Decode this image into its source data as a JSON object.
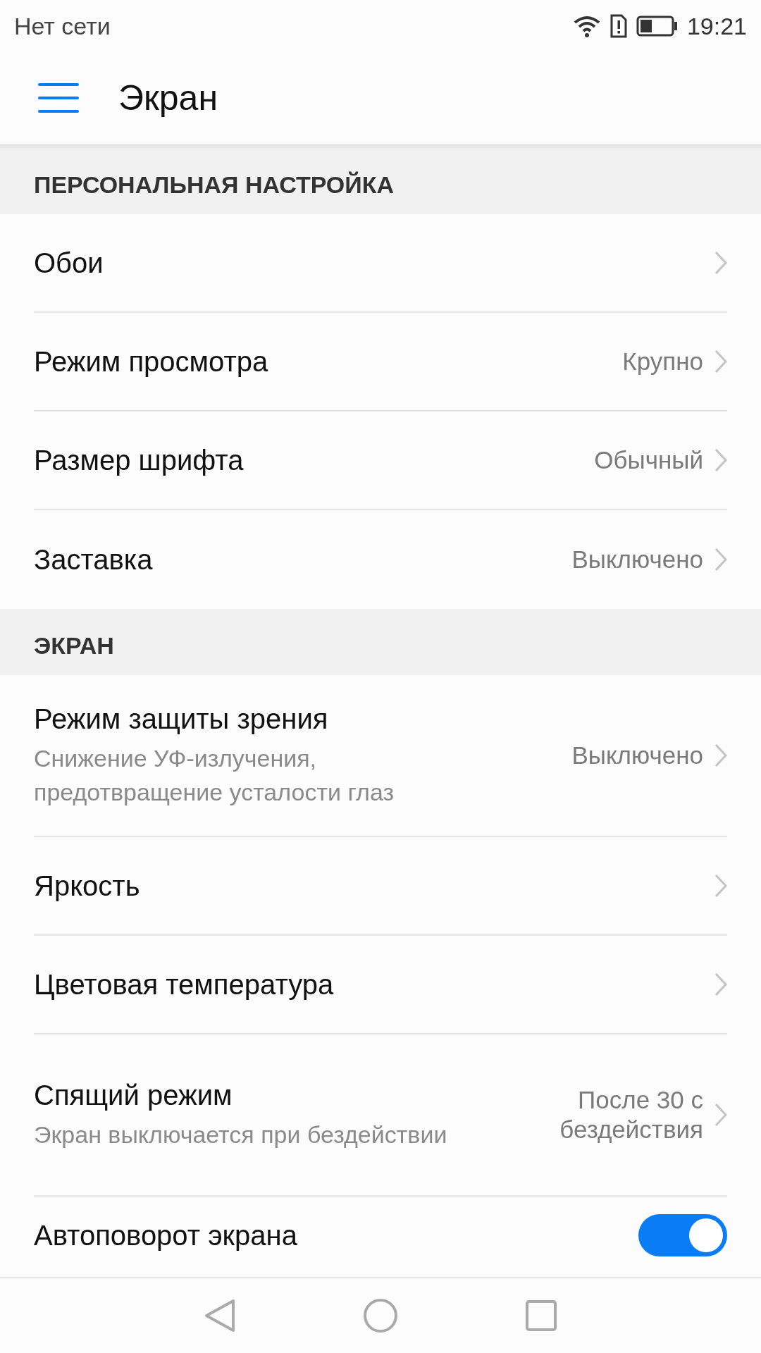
{
  "status_bar": {
    "carrier": "Нет сети",
    "time": "19:21"
  },
  "toolbar": {
    "title": "Экран"
  },
  "sections": [
    {
      "header": "ПЕРСОНАЛЬНАЯ НАСТРОЙКА",
      "items": [
        {
          "kind": "link",
          "title": "Обои"
        },
        {
          "kind": "link",
          "title": "Режим просмотра",
          "value": "Крупно"
        },
        {
          "kind": "link",
          "title": "Размер шрифта",
          "value": "Обычный"
        },
        {
          "kind": "link",
          "title": "Заставка",
          "value": "Выключено"
        }
      ]
    },
    {
      "header": "ЭКРАН",
      "items": [
        {
          "kind": "link",
          "title": "Режим защиты зрения",
          "subtitle": "Снижение УФ-излучения, предотвращение усталости глаз",
          "value": "Выключено"
        },
        {
          "kind": "link",
          "title": "Яркость"
        },
        {
          "kind": "link",
          "title": "Цветовая температура"
        },
        {
          "kind": "link",
          "title": "Спящий режим",
          "subtitle": "Экран выключается при бездействии",
          "value": "После 30 с бездействия"
        },
        {
          "kind": "toggle",
          "title": "Автоповорот экрана",
          "on": true
        }
      ]
    }
  ]
}
